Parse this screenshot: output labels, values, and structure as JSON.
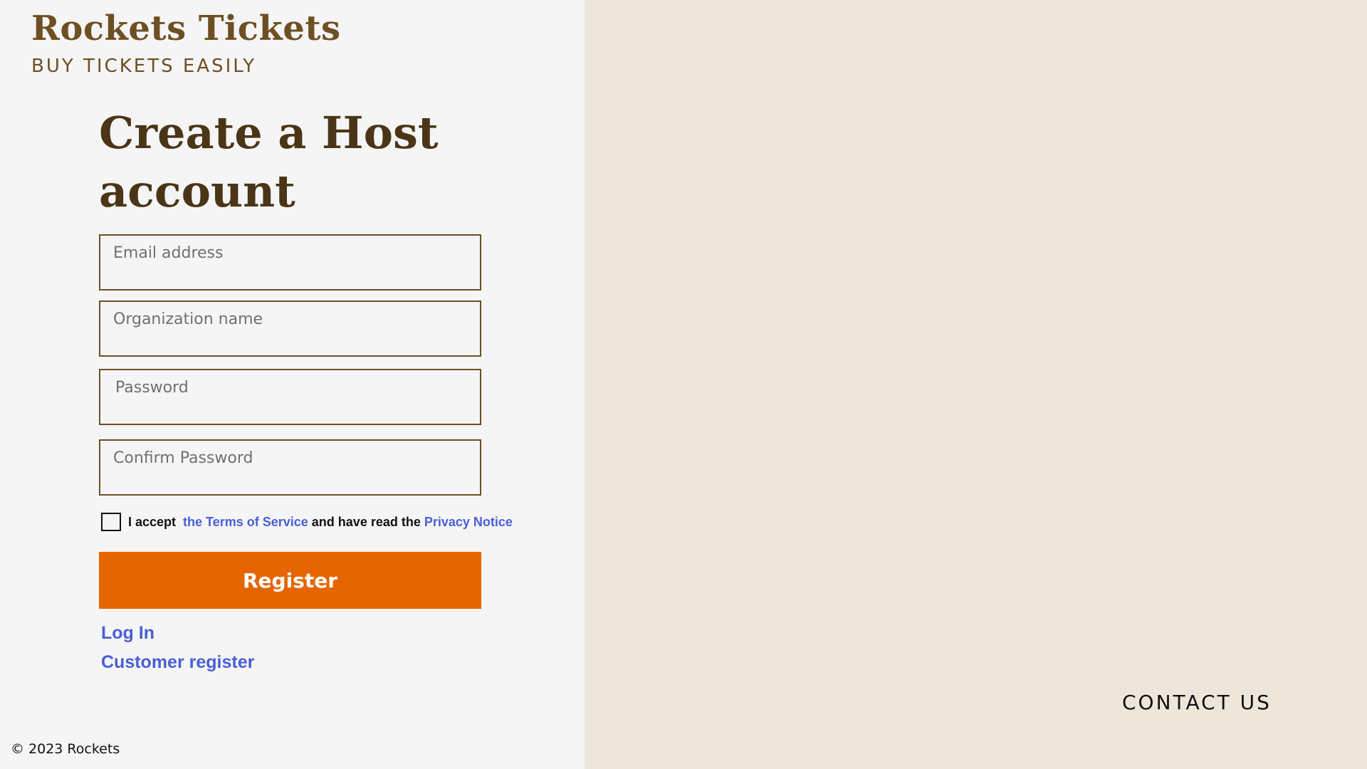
{
  "brand": {
    "title": "Rockets Tickets",
    "tagline": "BUY TICKETS EASILY"
  },
  "form": {
    "title_line1": "Create a Host",
    "title_line2": "account",
    "email": {
      "placeholder": "Email address",
      "value": ""
    },
    "organization": {
      "placeholder": "Organization name",
      "value": ""
    },
    "password": {
      "placeholder": "Password",
      "value": ""
    },
    "confirm_password": {
      "placeholder": "Confirm Password",
      "value": ""
    },
    "consent": {
      "checked": false,
      "prefix": "I accept ",
      "terms_link": "the Terms of Service",
      "middle": " and have read the ",
      "privacy_link": "Privacy Notice"
    },
    "register_label": "Register"
  },
  "links": {
    "login": "Log In",
    "customer_register": "Customer register"
  },
  "footer": {
    "copyright": "© 2023 Rockets",
    "contact": "CONTACT US"
  },
  "colors": {
    "brand_brown": "#6e4f24",
    "title_brown": "#4a3517",
    "accent_orange": "#e56500",
    "link_blue": "#4a5fd6",
    "right_panel_bg": "#efe6db",
    "left_panel_bg": "#f5f5f5"
  }
}
